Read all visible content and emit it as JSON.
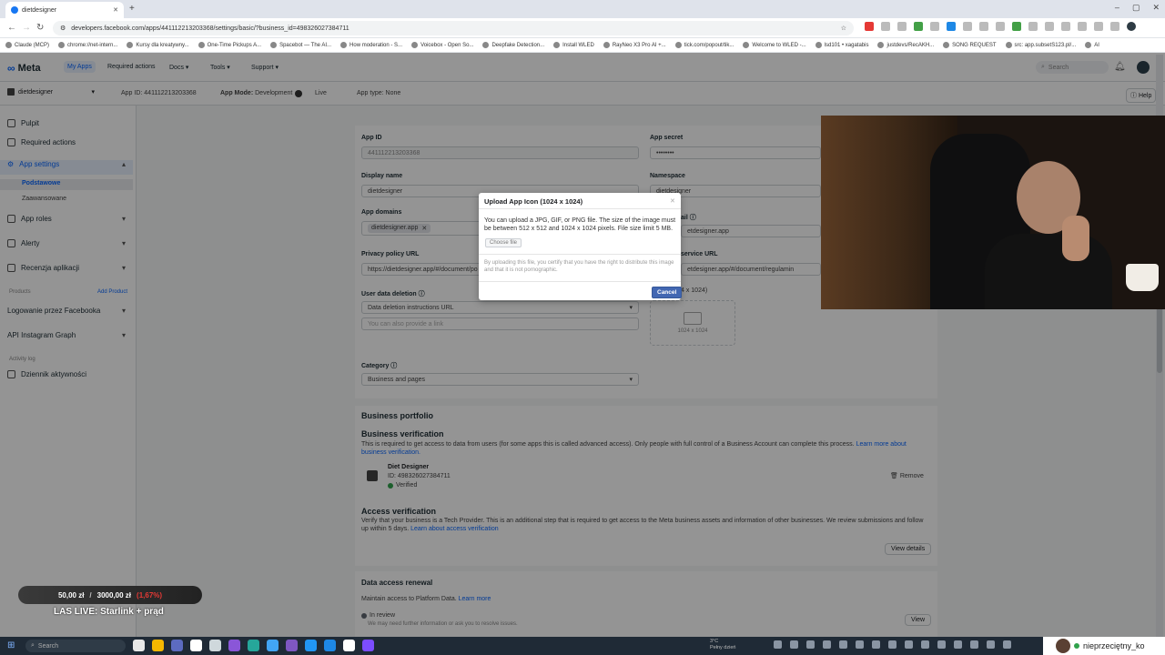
{
  "browser": {
    "tab_title": "dietdesigner",
    "url": "developers.facebook.com/apps/441112213203368/settings/basic/?business_id=498326027384711",
    "bookmarks": [
      "Claude (MCP)",
      "chrome://net-intern...",
      "Kursy dla kreatywny...",
      "One-Time Pickups A...",
      "Spacebot — The AI...",
      "How moderation - S...",
      "Voicebox - Open So...",
      "Deepfake Detection...",
      "Install WLED",
      "RayNeo X3 Pro AI +...",
      "tick.com/popout/tik...",
      "Welcome to WLED -...",
      "lsd101 • xagatabis",
      "justdevs/RecAKH...",
      "SONG REQUEST",
      "src: app.subsetS123.pl/...",
      "AI"
    ]
  },
  "topnav": {
    "brand": "Meta",
    "my_apps": "My Apps",
    "required_actions": "Required actions",
    "docs": "Docs",
    "tools": "Tools",
    "support": "Support",
    "search_placeholder": "Search"
  },
  "subnav": {
    "app_name": "dietdesigner",
    "app_id": "App ID: 441112213203368",
    "app_mode_label": "App Mode:",
    "app_mode_value": "Development",
    "live": "Live",
    "app_type": "App type: None",
    "help": "Help"
  },
  "sidebar": {
    "pulpit": "Pulpit",
    "required_actions": "Required actions",
    "app_settings": "App settings",
    "podstawowe": "Podstawowe",
    "zaawansowane": "Zaawansowane",
    "app_roles": "App roles",
    "alerty": "Alerty",
    "recenzja": "Recenzja aplikacji",
    "products": "Products",
    "add_product": "Add Product",
    "fb_login": "Logowanie przez Facebooka",
    "ig_graph": "API Instagram Graph",
    "activity_log": "Activity log",
    "dziennik": "Dziennik aktywności"
  },
  "form": {
    "app_id_label": "App ID",
    "app_id_value": "441112213203368",
    "app_secret_label": "App secret",
    "app_secret_value": "••••••••",
    "display_name_label": "Display name",
    "display_name_value": "dietdesigner",
    "namespace_label": "Namespace",
    "namespace_value": "dietdesigner",
    "app_domains_label": "App domains",
    "app_domain_chip": "dietdesigner.app",
    "contact_email_label": "ail",
    "contact_email_value": "etdesigner.app",
    "privacy_label": "Privacy policy URL",
    "privacy_value": "https://dietdesigner.app/#/document/po",
    "tos_label": "service URL",
    "tos_value": "etdesigner.app/#/document/regulamin",
    "user_data_deletion_label": "User data deletion",
    "user_data_deletion_value": "Data deletion instructions URL",
    "user_data_hint": "You can also provide a link",
    "icon_size": "4 x 1024)",
    "dropzone_text": "1024 x 1024",
    "category_label": "Category",
    "category_value": "Business and pages"
  },
  "business": {
    "portfolio_title": "Business portfolio",
    "verification_title": "Business verification",
    "verification_text": "This is required to get access to data from users (for some apps this is called advanced access). Only people with full control of a Business Account can complete this process.",
    "learn_more": "Learn more about business verification.",
    "biz_name": "Diet Designer",
    "biz_id": "ID: 498326027384711",
    "biz_status": "Verified",
    "remove": "Remove",
    "access_title": "Access verification",
    "access_text": "Verify that your business is a Tech Provider. This is an additional step that is required to get access to the Meta business assets and information of other businesses. We review submissions and follow up within 5 days.",
    "access_link": "Learn about access verification",
    "view_details": "View details",
    "renewal_title": "Data access renewal",
    "renewal_text": "Maintain access to Platform Data.",
    "renewal_link": "Learn more",
    "in_review": "In review",
    "renewal_note": "We may need further information or ask you to resolve issues.",
    "view": "View"
  },
  "modal": {
    "title": "Upload App Icon (1024 x 1024)",
    "body": "You can upload a JPG, GIF, or PNG file. The size of the image must be between 512 x 512 and 1024 x 1024 pixels. File size limit 5 MB.",
    "choose_file": "Choose file",
    "note": "By uploading this file, you certify that you have the right to distribute this image and that it is not pornographic.",
    "cancel": "Cancel"
  },
  "stream": {
    "goal_current": "50,00 zł",
    "goal_target": "3000,00 zł",
    "goal_extra": "(1,67%)",
    "live_title": "LAS LIVE: Starlink + prąd",
    "nickname": "nieprzeciętny_ko"
  },
  "taskbar": {
    "search_placeholder": "Search",
    "weather_temp": "3°C",
    "weather_desc": "Pełny dzień",
    "icon_colors": [
      "#e8e8e8",
      "#f5b800",
      "#5c6bc0",
      "#ffffff",
      "#cfd8dc",
      "#8a56d8",
      "#26a69a",
      "#42a5f5",
      "#7e57c2",
      "#2196f3",
      "#1e88e5",
      "#ffffff",
      "#7c4dff"
    ]
  },
  "colors": {
    "meta_blue": "#0866ff",
    "modal_button": "#4267b2",
    "verified_green": "#31a24c"
  }
}
